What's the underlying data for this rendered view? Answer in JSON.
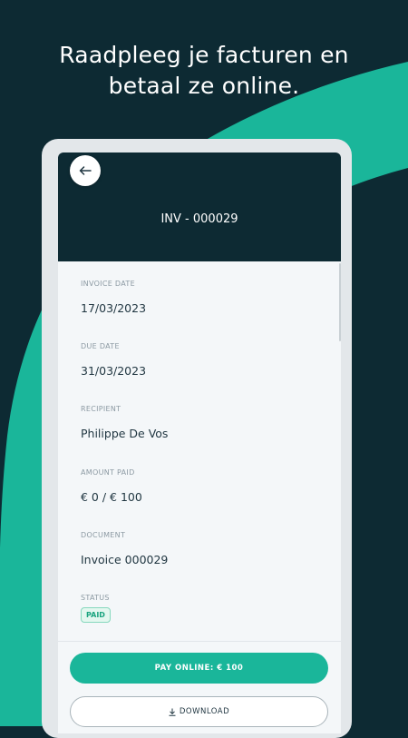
{
  "colors": {
    "background": "#0d2a33",
    "accent": "#1ab69a",
    "panel": "#0d2a33"
  },
  "headline": {
    "line1": "Raadpleeg je facturen en",
    "line2": "betaal ze online."
  },
  "invoice": {
    "number": "INV - 000029",
    "fields": [
      {
        "label": "INVOICE DATE",
        "value": "17/03/2023"
      },
      {
        "label": "DUE DATE",
        "value": "31/03/2023"
      },
      {
        "label": "RECIPIENT",
        "value": "Philippe De Vos"
      },
      {
        "label": "AMOUNT PAID",
        "value": "€ 0 / € 100"
      },
      {
        "label": "DOCUMENT",
        "value": "Invoice 000029"
      }
    ],
    "status": {
      "label": "STATUS",
      "value": "PAID"
    }
  },
  "icons": {
    "back": "arrow-left-icon",
    "download": "download-icon"
  },
  "actions": {
    "pay_label": "PAY ONLINE: € 100",
    "download_label": "DOWNLOAD"
  }
}
